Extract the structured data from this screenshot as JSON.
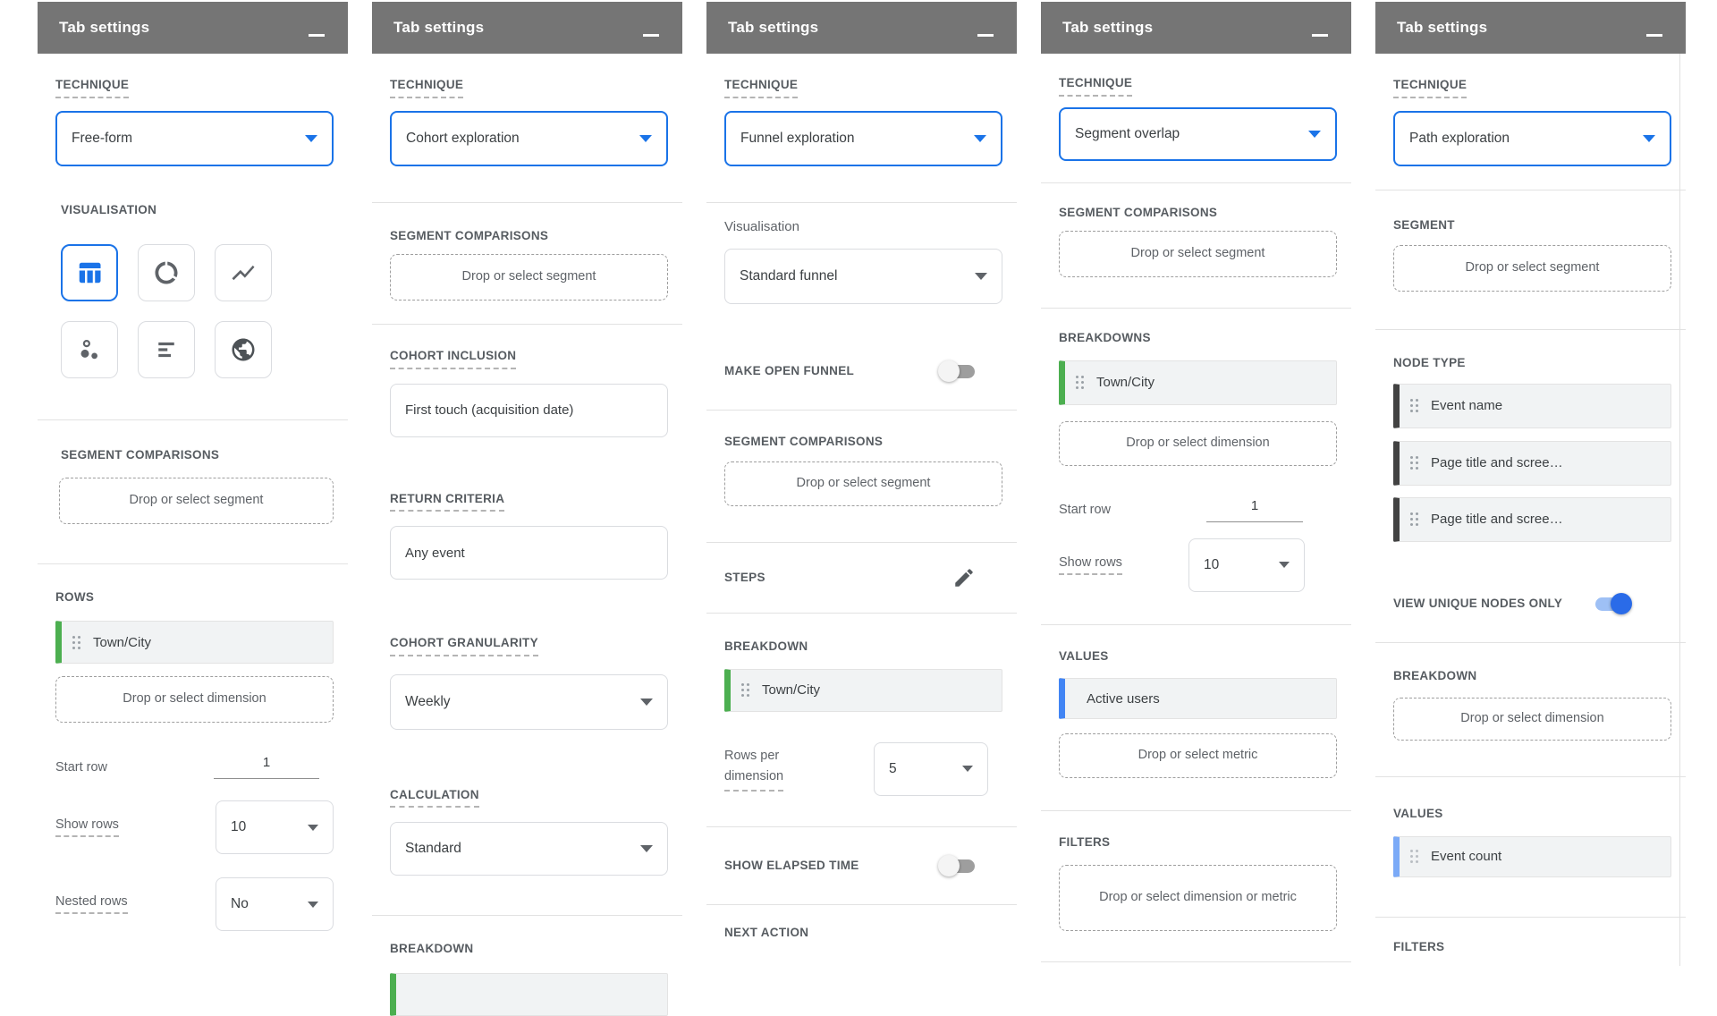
{
  "panel_title": "Tab settings",
  "colors": {
    "header_bg": "#757575",
    "accent_blue": "#1a73e8",
    "chip_green": "#4caf50",
    "chip_dark_gray": "#424242",
    "chip_blue": "#4285f4",
    "chip_light_blue": "#7baaf7",
    "toggle_on": "#2a6be8",
    "toggle_off_track": "#9e9e9e"
  },
  "icons": {
    "minimize": "minus-bar",
    "dropdown": "caret-down",
    "drag": "drag-handle-dots",
    "edit": "pencil",
    "visualisation": [
      "table",
      "donut-chart",
      "line-chart",
      "scatter",
      "bar-list",
      "globe"
    ]
  },
  "panels": {
    "freeform": {
      "technique_label": "TECHNIQUE",
      "technique": "Free-form",
      "visualisation_label": "VISUALISATION",
      "segment_comparisons_label": "SEGMENT COMPARISONS",
      "segment_drop": "Drop or select segment",
      "rows_label": "ROWS",
      "row_dimension": "Town/City",
      "dimension_drop": "Drop or select dimension",
      "start_row_label": "Start row",
      "start_row": "1",
      "show_rows_label": "Show rows",
      "show_rows": "10",
      "nested_rows_label": "Nested rows",
      "nested_rows": "No"
    },
    "cohort": {
      "technique_label": "TECHNIQUE",
      "technique": "Cohort exploration",
      "segment_comparisons_label": "SEGMENT COMPARISONS",
      "segment_drop": "Drop or select segment",
      "cohort_inclusion_label": "COHORT INCLUSION",
      "cohort_inclusion": "First touch (acquisition date)",
      "return_criteria_label": "RETURN CRITERIA",
      "return_criteria": "Any event",
      "granularity_label": "COHORT GRANULARITY",
      "granularity": "Weekly",
      "calculation_label": "CALCULATION",
      "calculation": "Standard",
      "breakdown_label": "BREAKDOWN"
    },
    "funnel": {
      "technique_label": "TECHNIQUE",
      "technique": "Funnel exploration",
      "visualisation_label": "Visualisation",
      "visualisation": "Standard funnel",
      "open_funnel_label": "MAKE OPEN FUNNEL",
      "segment_comparisons_label": "SEGMENT COMPARISONS",
      "segment_drop": "Drop or select segment",
      "steps_label": "STEPS",
      "breakdown_label": "BREAKDOWN",
      "breakdown_dimension": "Town/City",
      "rows_per_line1": "Rows per",
      "rows_per_line2": "dimension",
      "rows_per_value": "5",
      "elapsed_label": "SHOW ELAPSED TIME",
      "next_action_label": "NEXT ACTION"
    },
    "segment_overlap": {
      "technique_label": "TECHNIQUE",
      "technique": "Segment overlap",
      "segment_comparisons_label": "SEGMENT COMPARISONS",
      "segment_drop": "Drop or select segment",
      "breakdowns_label": "BREAKDOWNS",
      "breakdown_dimension": "Town/City",
      "dimension_drop": "Drop or select dimension",
      "start_row_label": "Start row",
      "start_row": "1",
      "show_rows_label": "Show rows",
      "show_rows": "10",
      "values_label": "VALUES",
      "value_metric": "Active users",
      "metric_drop": "Drop or select metric",
      "filters_label": "FILTERS",
      "filter_drop": "Drop or select dimension or metric"
    },
    "path": {
      "technique_label": "TECHNIQUE",
      "technique": "Path exploration",
      "segment_label": "SEGMENT",
      "segment_drop": "Drop or select segment",
      "node_type_label": "NODE TYPE",
      "nodes": [
        "Event name",
        "Page title and scree…",
        "Page title and scree…"
      ],
      "unique_nodes_label": "VIEW UNIQUE NODES ONLY",
      "breakdown_label": "BREAKDOWN",
      "dimension_drop": "Drop or select dimension",
      "values_label": "VALUES",
      "value_metric": "Event count",
      "filters_label": "FILTERS"
    }
  }
}
